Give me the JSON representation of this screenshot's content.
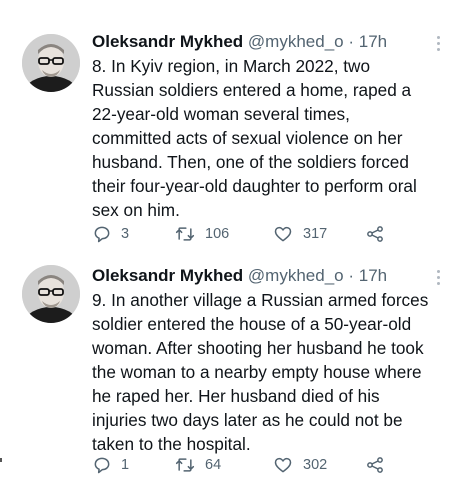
{
  "tweets": [
    {
      "author": {
        "name": "Oleksandr Mykhed",
        "handle": "@mykhed_o"
      },
      "separator": "·",
      "time": "17h",
      "lines": [
        "8. In Kyiv region, in March 2022, two",
        "Russian soldiers entered a home, raped a",
        "22-year-old woman several times,",
        "committed acts of sexual violence on her",
        "husband. Then, one of the soldiers forced",
        "their four-year-old daughter to perform oral",
        "sex on him."
      ],
      "actions": {
        "replies": "3",
        "retweets": "106",
        "likes": "317"
      }
    },
    {
      "author": {
        "name": "Oleksandr Mykhed",
        "handle": "@mykhed_o"
      },
      "separator": "·",
      "time": "17h",
      "lines": [
        "9. In another village a Russian armed forces",
        "soldier entered the house of a 50-year-old",
        "woman. After shooting her husband he took",
        "the woman to a nearby empty house where",
        "he raped her. Her husband died of his",
        "injuries two days later as he could not be",
        "taken to the hospital."
      ],
      "actions": {
        "replies": "1",
        "retweets": "64",
        "likes": "302"
      }
    }
  ],
  "icons": {
    "reply": "reply-icon",
    "retweet": "retweet-icon",
    "like": "heart-icon",
    "share": "share-icon",
    "more": "more-icon"
  },
  "colors": {
    "text": "#0f1419",
    "secondary": "#536471",
    "background": "#ffffff"
  }
}
